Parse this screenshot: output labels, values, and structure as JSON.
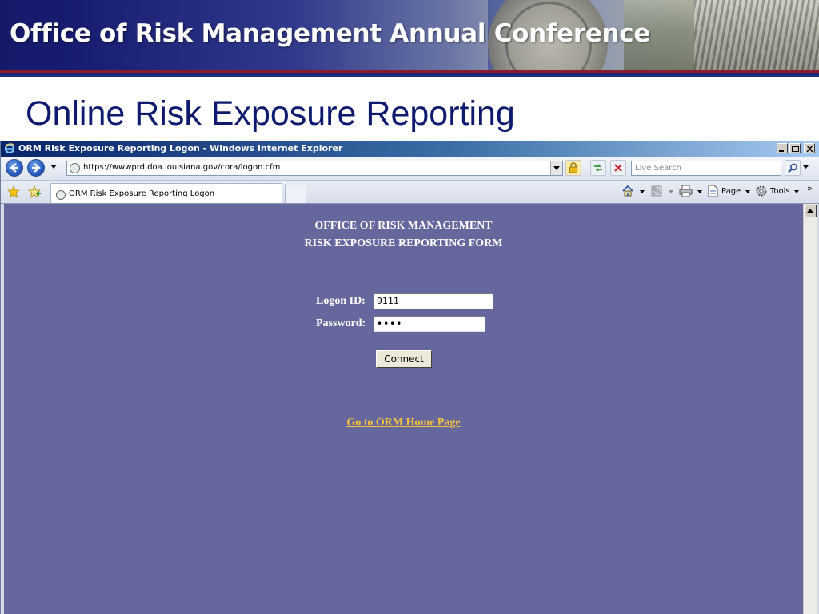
{
  "slide": {
    "header_title": "Office of Risk Management Annual Conference",
    "title": "Online Risk Exposure Reporting"
  },
  "browser": {
    "window_title": "ORM Risk Exposure Reporting Logon - Windows Internet Explorer",
    "address": "https://wwwprd.doa.louisiana.gov/cora/logon.cfm",
    "search_placeholder": "Live Search",
    "tab_label": "ORM Risk Exposure Reporting Logon",
    "page_label": "Page",
    "tools_label": "Tools"
  },
  "form": {
    "heading_1": "OFFICE OF RISK MANAGEMENT",
    "heading_2": "RISK EXPOSURE REPORTING FORM",
    "logon_label": "Logon ID:",
    "logon_value": "9111",
    "password_label": "Password:",
    "password_value": "••••",
    "connect_label": "Connect",
    "home_link": "Go to ORM Home Page"
  },
  "colors": {
    "header_navy": "#15196a",
    "slide_title": "#0d1a6e",
    "page_background": "#66679c",
    "link": "#f7c33b"
  },
  "icons": [
    "ie-logo-icon",
    "minimize-icon",
    "maximize-icon",
    "close-icon",
    "back-icon",
    "forward-icon",
    "page-icon",
    "lock-icon",
    "refresh-icon",
    "stop-icon",
    "search-icon",
    "favorites-star-icon",
    "add-favorite-icon",
    "home-icon",
    "feeds-icon",
    "print-icon",
    "page-menu-icon",
    "tools-gear-icon",
    "scroll-up-icon"
  ]
}
